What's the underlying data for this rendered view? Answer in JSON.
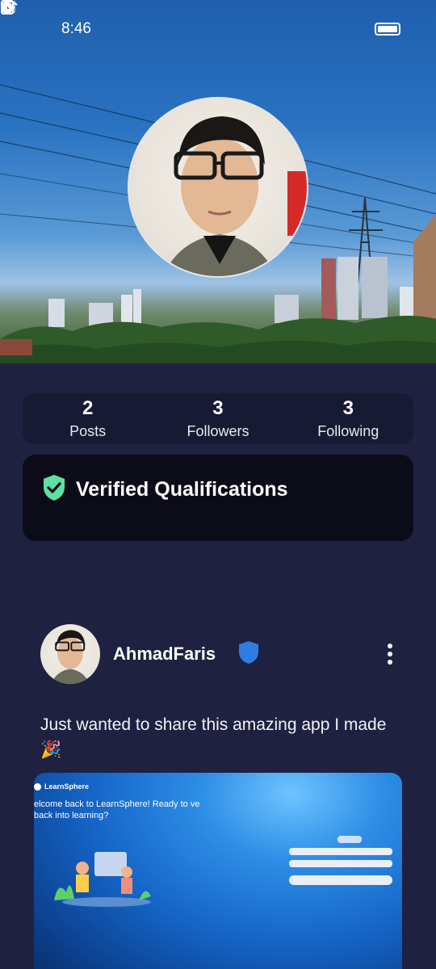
{
  "status_bar": {
    "time": "8:46"
  },
  "profile": {
    "stats": [
      {
        "value": "2",
        "label": "Posts"
      },
      {
        "value": "3",
        "label": "Followers"
      },
      {
        "value": "3",
        "label": "Following"
      }
    ],
    "verified_title": "Verified Qualifications"
  },
  "post": {
    "username": "AhmadFaris",
    "text": "Just wanted to share this amazing app I made 🎉",
    "image": {
      "brand": "LearnSphere",
      "welcome": "elcome back to LearnSphere! Ready to ve back into learning?"
    }
  },
  "colors": {
    "background": "#1f2140",
    "stats_card": "#171a33",
    "verified_card": "#0b0c18",
    "verified_shield": "#5fe0a0",
    "user_badge": "#2f7de0"
  },
  "icons": [
    "nfc-icon",
    "alarm-icon",
    "bluetooth-icon",
    "wifi-icon",
    "signal-icon",
    "battery-icon",
    "shield-check-icon",
    "verified-badge-icon",
    "more-vertical-icon"
  ]
}
